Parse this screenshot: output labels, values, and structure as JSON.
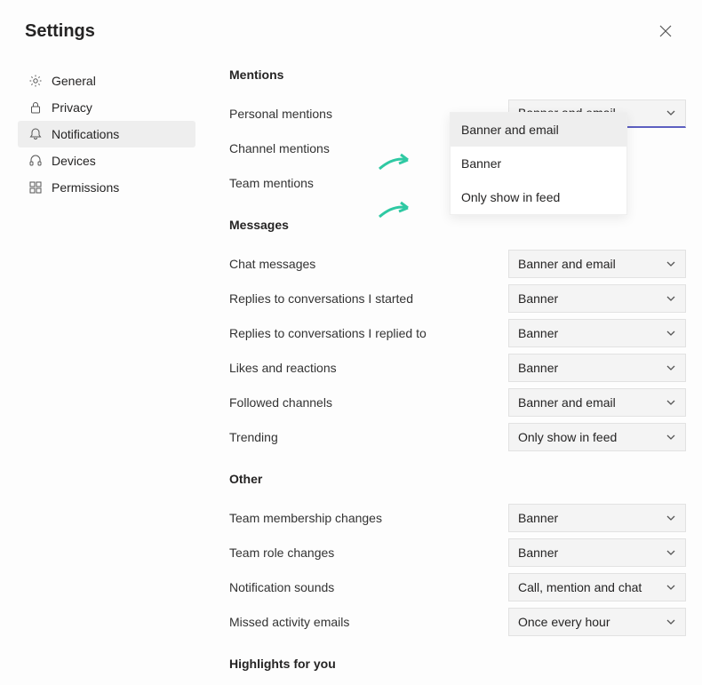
{
  "header": {
    "title": "Settings"
  },
  "sidebar": {
    "items": [
      {
        "label": "General"
      },
      {
        "label": "Privacy"
      },
      {
        "label": "Notifications"
      },
      {
        "label": "Devices"
      },
      {
        "label": "Permissions"
      }
    ],
    "active_index": 2
  },
  "sections": {
    "mentions": {
      "title": "Mentions",
      "rows": [
        {
          "label": "Personal mentions",
          "value": "Banner and email"
        },
        {
          "label": "Channel mentions",
          "value": ""
        },
        {
          "label": "Team mentions",
          "value": ""
        }
      ]
    },
    "messages": {
      "title": "Messages",
      "rows": [
        {
          "label": "Chat messages",
          "value": "Banner and email"
        },
        {
          "label": "Replies to conversations I started",
          "value": "Banner"
        },
        {
          "label": "Replies to conversations I replied to",
          "value": "Banner"
        },
        {
          "label": "Likes and reactions",
          "value": "Banner"
        },
        {
          "label": "Followed channels",
          "value": "Banner and email"
        },
        {
          "label": "Trending",
          "value": "Only show in feed"
        }
      ]
    },
    "other": {
      "title": "Other",
      "rows": [
        {
          "label": "Team membership changes",
          "value": "Banner"
        },
        {
          "label": "Team role changes",
          "value": "Banner"
        },
        {
          "label": "Notification sounds",
          "value": "Call, mention and chat"
        },
        {
          "label": "Missed activity emails",
          "value": "Once every hour"
        }
      ]
    },
    "highlights": {
      "title": "Highlights for you"
    }
  },
  "dropdown": {
    "options": [
      "Banner and email",
      "Banner",
      "Only show in feed"
    ],
    "selected_index": 0
  },
  "annotation": {
    "arrow_color": "#2fc9a3"
  }
}
